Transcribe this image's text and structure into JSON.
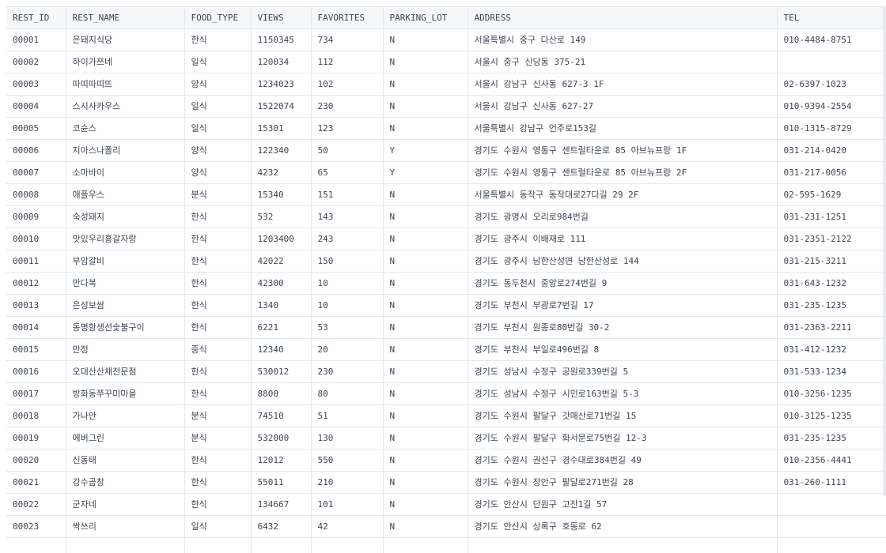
{
  "table": {
    "columns": [
      "REST_ID",
      "REST_NAME",
      "FOOD_TYPE",
      "VIEWS",
      "FAVORITES",
      "PARKING_LOT",
      "ADDRESS",
      "TEL"
    ],
    "rows": [
      [
        "00001",
        "은돼지식당",
        "한식",
        "1150345",
        "734",
        "N",
        "서울특별시 중구 다산로 149",
        "010-4484-8751"
      ],
      [
        "00002",
        "하이가쯔네",
        "일식",
        "120034",
        "112",
        "N",
        "서울시 중구 신당동 375-21",
        ""
      ],
      [
        "00003",
        "따띠따띠뜨",
        "양식",
        "1234023",
        "102",
        "N",
        "서울시 강남구 신사동 627-3 1F",
        "02-6397-1023"
      ],
      [
        "00004",
        "스시사카우스",
        "일식",
        "1522074",
        "230",
        "N",
        "서울시 강남구 신사동 627-27",
        "010-9394-2554"
      ],
      [
        "00005",
        "코슌스",
        "일식",
        "15301",
        "123",
        "N",
        "서울특별시 강남구 언주로153길",
        "010-1315-8729"
      ],
      [
        "00006",
        "지아스나폴리",
        "양식",
        "122340",
        "50",
        "Y",
        "경기도 수원시 영통구 센트럴타운로 85 아브뉴프랑 1F",
        "031-214-0420"
      ],
      [
        "00007",
        "소마바이",
        "양식",
        "4232",
        "65",
        "Y",
        "경기도 수원시 영통구 센트럴타운로 85 아브뉴프랑 2F",
        "031-217-0056"
      ],
      [
        "00008",
        "애플우스",
        "분식",
        "15340",
        "151",
        "N",
        "서울특별시 동작구 동작대로27다길 29 2F",
        "02-595-1629"
      ],
      [
        "00009",
        "숙성돼지",
        "한식",
        "532",
        "143",
        "N",
        "경기도 광명시 오리로984번길",
        "031-231-1251"
      ],
      [
        "00010",
        "맛있우리흥갈자랑",
        "한식",
        "1203400",
        "243",
        "N",
        "경기도 광주시 이배재로 111",
        "031-2351-2122"
      ],
      [
        "00011",
        "부암갈비",
        "한식",
        "42022",
        "150",
        "N",
        "경기도 광주시 남한산성면 남한산성로 144",
        "031-215-3211"
      ],
      [
        "00012",
        "만다복",
        "한식",
        "42300",
        "10",
        "N",
        "경기도 동두천시 중앙로274번길 9",
        "031-643-1232"
      ],
      [
        "00013",
        "은성보쌈",
        "한식",
        "1340",
        "10",
        "N",
        "경기도 부천시 부광로7번길 17",
        "031-235-1235"
      ],
      [
        "00014",
        "동명항생선숯불구이",
        "한식",
        "6221",
        "53",
        "N",
        "경기도 부천시 원종로80번길 30-2",
        "031-2363-2211"
      ],
      [
        "00015",
        "만정",
        "중식",
        "12340",
        "20",
        "N",
        "경기도 부천시 부일로496번길 8",
        "031-412-1232"
      ],
      [
        "00016",
        "오대산산채전문점",
        "한식",
        "530012",
        "230",
        "N",
        "경기도 성남시 수정구 공원로339번길 5",
        "031-533-1234"
      ],
      [
        "00017",
        "방화동쭈꾸미마을",
        "한식",
        "8800",
        "80",
        "N",
        "경기도 성남시 수정구 시민로163번길 5-3",
        "010-3256-1235"
      ],
      [
        "00018",
        "가나안",
        "분식",
        "74510",
        "51",
        "N",
        "경기도 수원시 팔달구 갓매산로71번길 15",
        "010-3125-1235"
      ],
      [
        "00019",
        "에버그린",
        "분식",
        "532000",
        "130",
        "N",
        "경기도 수원시 팔달구 화서문로75번길 12-3",
        "031-235-1235"
      ],
      [
        "00020",
        "신동태",
        "한식",
        "12012",
        "550",
        "N",
        "경기도 수원시 권선구 경수대로384번길 49",
        "010-2356-4441"
      ],
      [
        "00021",
        "강수곱창",
        "한식",
        "55011",
        "210",
        "N",
        "경기도 수원시 장안구 팔달로271번길 28",
        "031-260-1111"
      ],
      [
        "00022",
        "군자네",
        "한식",
        "134667",
        "101",
        "N",
        "경기도 안산시 단원구 고잔1길 57",
        ""
      ],
      [
        "00023",
        "싹쓰리",
        "일식",
        "6432",
        "42",
        "N",
        "경기도 안산시 상록구 호동로 62",
        ""
      ],
      [
        "",
        "",
        "",
        "",
        "",
        "",
        "",
        ""
      ]
    ]
  }
}
